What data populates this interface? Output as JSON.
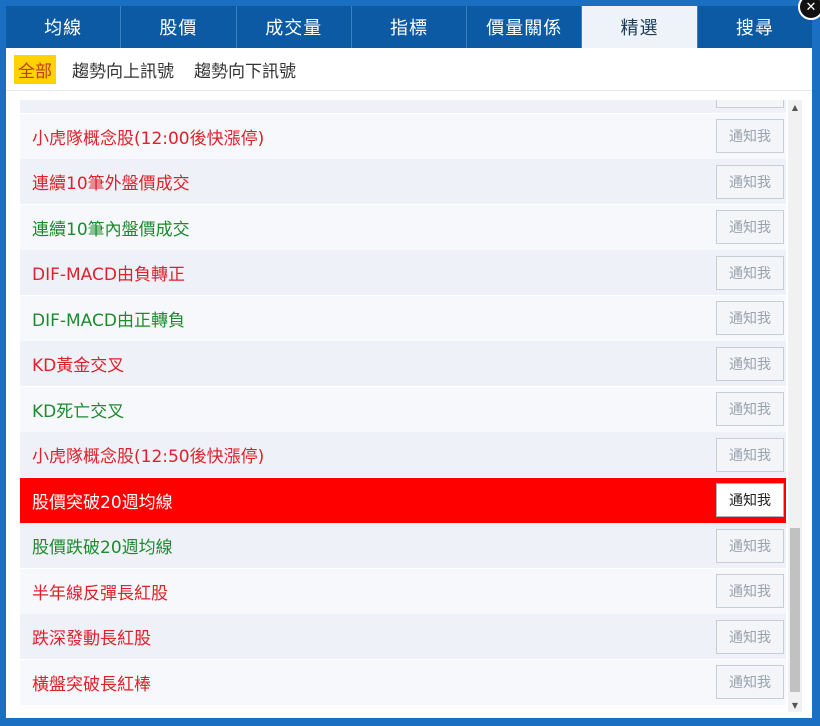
{
  "tabs": [
    {
      "label": "均線"
    },
    {
      "label": "股價"
    },
    {
      "label": "成交量"
    },
    {
      "label": "指標"
    },
    {
      "label": "價量關係"
    },
    {
      "label": "精選"
    },
    {
      "label": "搜尋"
    }
  ],
  "active_tab": "精選",
  "filters": [
    {
      "label": "全部"
    },
    {
      "label": "趨勢向上訊號"
    },
    {
      "label": "趨勢向下訊號"
    }
  ],
  "notify_label": "通知我",
  "items": [
    {
      "label": "",
      "color": "red"
    },
    {
      "label": "小虎隊概念股(12:00後快漲停)",
      "color": "red"
    },
    {
      "label": "連續10筆外盤價成交",
      "color": "red"
    },
    {
      "label": "連續10筆內盤價成交",
      "color": "green"
    },
    {
      "label": "DIF-MACD由負轉正",
      "color": "red"
    },
    {
      "label": "DIF-MACD由正轉負",
      "color": "green"
    },
    {
      "label": "KD黃金交叉",
      "color": "red"
    },
    {
      "label": "KD死亡交叉",
      "color": "green"
    },
    {
      "label": "小虎隊概念股(12:50後快漲停)",
      "color": "red"
    },
    {
      "label": "股價突破20週均線",
      "color": "red",
      "selected": true
    },
    {
      "label": "股價跌破20週均線",
      "color": "green"
    },
    {
      "label": "半年線反彈長紅股",
      "color": "red"
    },
    {
      "label": "跌深發動長紅股",
      "color": "red"
    },
    {
      "label": "橫盤突破長紅棒",
      "color": "red"
    }
  ],
  "colors": {
    "tab_bar": "#0b5aa3",
    "highlight_row": "#ff0000",
    "red_text": "#e0202a",
    "green_text": "#1e8a2e",
    "active_filter": "#ffd200"
  }
}
